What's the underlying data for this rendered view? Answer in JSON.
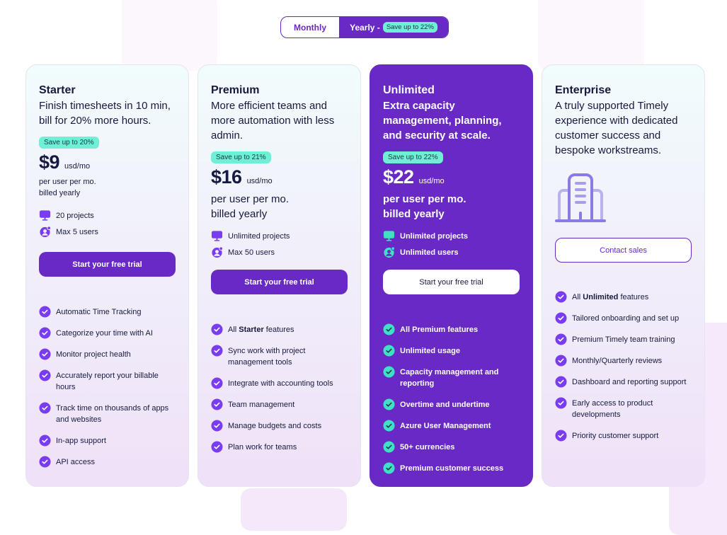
{
  "billing_toggle": {
    "monthly_label": "Monthly",
    "yearly_label": "Yearly -",
    "yearly_badge": "Save up to 22%",
    "selected": "Yearly"
  },
  "colors": {
    "brand_purple": "#6929c4",
    "mint_badge": "#6ff0d6",
    "dark_text": "#161a3f"
  },
  "plans": [
    {
      "name": "Starter",
      "description": "Finish timesheets in 10 min, bill for 20% more hours.",
      "save_badge": "Save up to 20%",
      "price": "$9",
      "unit": "usd/mo",
      "billing_line1": "per user per mo.",
      "billing_line2": "billed yearly",
      "limits": [
        {
          "icon": "monitor-icon",
          "text": "20 projects"
        },
        {
          "icon": "user-icon",
          "text": "Max 5 users"
        }
      ],
      "cta": "Start your free trial",
      "features": [
        {
          "text": "Automatic Time Tracking"
        },
        {
          "text": "Categorize your time with AI"
        },
        {
          "text": "Monitor project health"
        },
        {
          "text": "Accurately report your billable hours"
        },
        {
          "text": "Track time on thousands of apps and websites"
        },
        {
          "text": "In-app support"
        },
        {
          "text": "API access"
        }
      ]
    },
    {
      "name": "Premium",
      "description": "More efficient teams and more automation with less admin.",
      "save_badge": "Save up to 21%",
      "price": "$16",
      "unit": "usd/mo",
      "billing_line1": "per user per mo.",
      "billing_line2": "billed yearly",
      "limits": [
        {
          "icon": "monitor-icon",
          "text": "Unlimited projects"
        },
        {
          "icon": "user-icon",
          "text": "Max 50 users"
        }
      ],
      "cta": "Start your free trial",
      "features": [
        {
          "prefix": "All ",
          "bold": "Starter",
          "suffix": " features"
        },
        {
          "text": "Sync work with project management tools"
        },
        {
          "text": "Integrate with accounting tools"
        },
        {
          "text": "Team management"
        },
        {
          "text": "Manage budgets and costs"
        },
        {
          "text": "Plan work for teams"
        }
      ]
    },
    {
      "name": "Unlimited",
      "description": "Extra capacity management, planning, and security at scale.",
      "save_badge": "Save up to 22%",
      "price": "$22",
      "unit": "usd/mo",
      "billing_line1": "per user per mo.",
      "billing_line2": "billed yearly",
      "limits": [
        {
          "icon": "monitor-icon",
          "text": "Unlimited projects"
        },
        {
          "icon": "user-icon",
          "text": "Unlimited users"
        }
      ],
      "cta": "Start your free trial",
      "features": [
        {
          "prefix": "All ",
          "bold": "Premium",
          "suffix": " features"
        },
        {
          "text": "Unlimited usage"
        },
        {
          "text": "Capacity management and reporting"
        },
        {
          "text": "Overtime and undertime"
        },
        {
          "text": "Azure User Management"
        },
        {
          "text": "50+ currencies"
        },
        {
          "text": "Premium customer success"
        }
      ]
    },
    {
      "name": "Enterprise",
      "description": "A truly supported Timely experience with dedicated customer success and bespoke workstreams.",
      "illustration": "building-icon",
      "cta": "Contact sales",
      "features": [
        {
          "prefix": "All ",
          "bold": "Unlimited",
          "suffix": " features"
        },
        {
          "text": "Tailored onboarding and set up"
        },
        {
          "text": "Premium Timely team training"
        },
        {
          "text": "Monthly/Quarterly reviews"
        },
        {
          "text": "Dashboard and reporting support"
        },
        {
          "text": "Early access to product developments"
        },
        {
          "text": "Priority customer support"
        }
      ]
    }
  ]
}
